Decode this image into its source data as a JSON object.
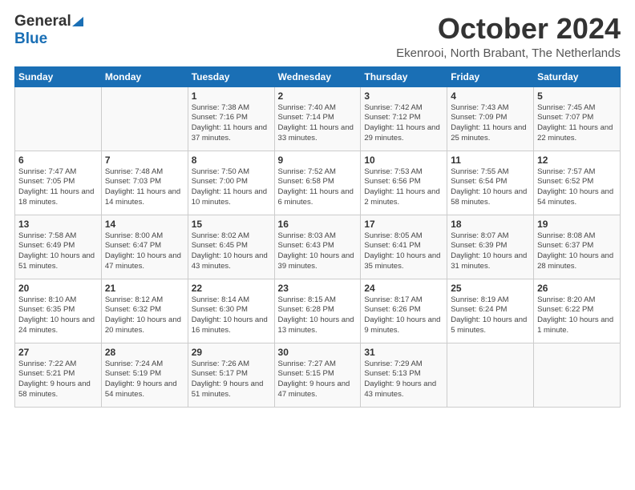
{
  "header": {
    "logo_general": "General",
    "logo_blue": "Blue",
    "month": "October 2024",
    "location": "Ekenrooi, North Brabant, The Netherlands"
  },
  "weekdays": [
    "Sunday",
    "Monday",
    "Tuesday",
    "Wednesday",
    "Thursday",
    "Friday",
    "Saturday"
  ],
  "weeks": [
    [
      {
        "day": "",
        "detail": ""
      },
      {
        "day": "",
        "detail": ""
      },
      {
        "day": "1",
        "detail": "Sunrise: 7:38 AM\nSunset: 7:16 PM\nDaylight: 11 hours\nand 37 minutes."
      },
      {
        "day": "2",
        "detail": "Sunrise: 7:40 AM\nSunset: 7:14 PM\nDaylight: 11 hours\nand 33 minutes."
      },
      {
        "day": "3",
        "detail": "Sunrise: 7:42 AM\nSunset: 7:12 PM\nDaylight: 11 hours\nand 29 minutes."
      },
      {
        "day": "4",
        "detail": "Sunrise: 7:43 AM\nSunset: 7:09 PM\nDaylight: 11 hours\nand 25 minutes."
      },
      {
        "day": "5",
        "detail": "Sunrise: 7:45 AM\nSunset: 7:07 PM\nDaylight: 11 hours\nand 22 minutes."
      }
    ],
    [
      {
        "day": "6",
        "detail": "Sunrise: 7:47 AM\nSunset: 7:05 PM\nDaylight: 11 hours\nand 18 minutes."
      },
      {
        "day": "7",
        "detail": "Sunrise: 7:48 AM\nSunset: 7:03 PM\nDaylight: 11 hours\nand 14 minutes."
      },
      {
        "day": "8",
        "detail": "Sunrise: 7:50 AM\nSunset: 7:00 PM\nDaylight: 11 hours\nand 10 minutes."
      },
      {
        "day": "9",
        "detail": "Sunrise: 7:52 AM\nSunset: 6:58 PM\nDaylight: 11 hours\nand 6 minutes."
      },
      {
        "day": "10",
        "detail": "Sunrise: 7:53 AM\nSunset: 6:56 PM\nDaylight: 11 hours\nand 2 minutes."
      },
      {
        "day": "11",
        "detail": "Sunrise: 7:55 AM\nSunset: 6:54 PM\nDaylight: 10 hours\nand 58 minutes."
      },
      {
        "day": "12",
        "detail": "Sunrise: 7:57 AM\nSunset: 6:52 PM\nDaylight: 10 hours\nand 54 minutes."
      }
    ],
    [
      {
        "day": "13",
        "detail": "Sunrise: 7:58 AM\nSunset: 6:49 PM\nDaylight: 10 hours\nand 51 minutes."
      },
      {
        "day": "14",
        "detail": "Sunrise: 8:00 AM\nSunset: 6:47 PM\nDaylight: 10 hours\nand 47 minutes."
      },
      {
        "day": "15",
        "detail": "Sunrise: 8:02 AM\nSunset: 6:45 PM\nDaylight: 10 hours\nand 43 minutes."
      },
      {
        "day": "16",
        "detail": "Sunrise: 8:03 AM\nSunset: 6:43 PM\nDaylight: 10 hours\nand 39 minutes."
      },
      {
        "day": "17",
        "detail": "Sunrise: 8:05 AM\nSunset: 6:41 PM\nDaylight: 10 hours\nand 35 minutes."
      },
      {
        "day": "18",
        "detail": "Sunrise: 8:07 AM\nSunset: 6:39 PM\nDaylight: 10 hours\nand 31 minutes."
      },
      {
        "day": "19",
        "detail": "Sunrise: 8:08 AM\nSunset: 6:37 PM\nDaylight: 10 hours\nand 28 minutes."
      }
    ],
    [
      {
        "day": "20",
        "detail": "Sunrise: 8:10 AM\nSunset: 6:35 PM\nDaylight: 10 hours\nand 24 minutes."
      },
      {
        "day": "21",
        "detail": "Sunrise: 8:12 AM\nSunset: 6:32 PM\nDaylight: 10 hours\nand 20 minutes."
      },
      {
        "day": "22",
        "detail": "Sunrise: 8:14 AM\nSunset: 6:30 PM\nDaylight: 10 hours\nand 16 minutes."
      },
      {
        "day": "23",
        "detail": "Sunrise: 8:15 AM\nSunset: 6:28 PM\nDaylight: 10 hours\nand 13 minutes."
      },
      {
        "day": "24",
        "detail": "Sunrise: 8:17 AM\nSunset: 6:26 PM\nDaylight: 10 hours\nand 9 minutes."
      },
      {
        "day": "25",
        "detail": "Sunrise: 8:19 AM\nSunset: 6:24 PM\nDaylight: 10 hours\nand 5 minutes."
      },
      {
        "day": "26",
        "detail": "Sunrise: 8:20 AM\nSunset: 6:22 PM\nDaylight: 10 hours\nand 1 minute."
      }
    ],
    [
      {
        "day": "27",
        "detail": "Sunrise: 7:22 AM\nSunset: 5:21 PM\nDaylight: 9 hours\nand 58 minutes."
      },
      {
        "day": "28",
        "detail": "Sunrise: 7:24 AM\nSunset: 5:19 PM\nDaylight: 9 hours\nand 54 minutes."
      },
      {
        "day": "29",
        "detail": "Sunrise: 7:26 AM\nSunset: 5:17 PM\nDaylight: 9 hours\nand 51 minutes."
      },
      {
        "day": "30",
        "detail": "Sunrise: 7:27 AM\nSunset: 5:15 PM\nDaylight: 9 hours\nand 47 minutes."
      },
      {
        "day": "31",
        "detail": "Sunrise: 7:29 AM\nSunset: 5:13 PM\nDaylight: 9 hours\nand 43 minutes."
      },
      {
        "day": "",
        "detail": ""
      },
      {
        "day": "",
        "detail": ""
      }
    ]
  ]
}
